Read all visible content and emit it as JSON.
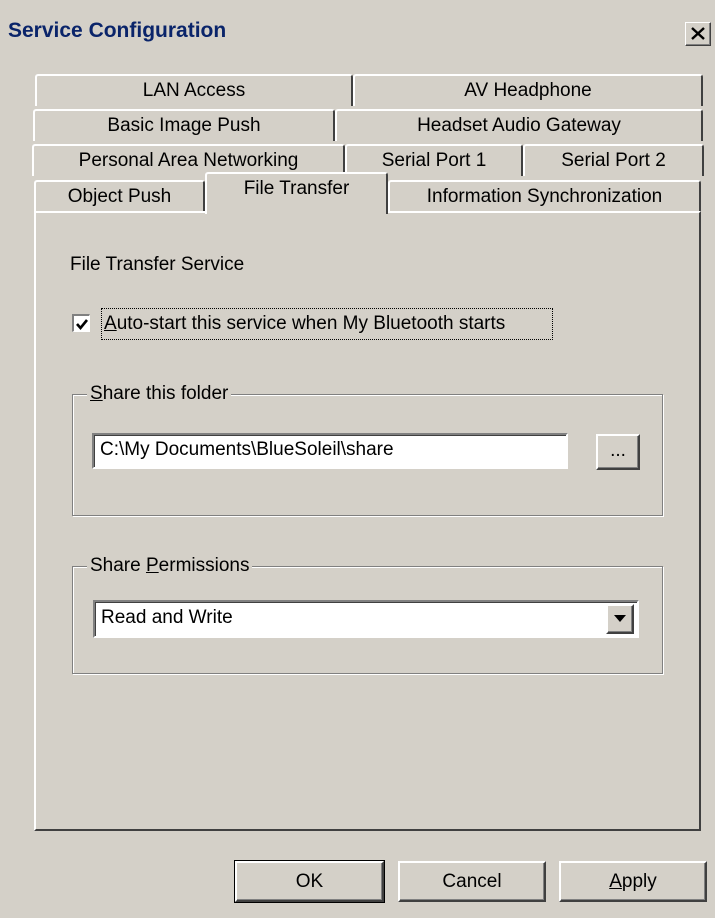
{
  "window": {
    "title": "Service Configuration",
    "close_icon": "close-icon"
  },
  "tabs": {
    "row1": [
      "LAN Access",
      "AV Headphone"
    ],
    "row2": [
      "Basic Image Push",
      "Headset Audio Gateway"
    ],
    "row3": [
      "Personal Area Networking",
      "Serial Port 1",
      "Serial Port 2"
    ],
    "row4": [
      "Object Push",
      "File Transfer",
      "Information Synchronization"
    ],
    "active": "File Transfer"
  },
  "panel": {
    "heading": "File Transfer Service",
    "autostart": {
      "checked": true,
      "label_accel": "A",
      "label_rest": "uto-start this service when My Bluetooth starts"
    },
    "share_folder": {
      "legend_accel": "S",
      "legend_rest": "hare this folder",
      "path": "C:\\My Documents\\BlueSoleil\\share",
      "browse_label": "..."
    },
    "share_permissions": {
      "legend_pre": "Share ",
      "legend_accel": "P",
      "legend_rest": "ermissions",
      "selected": "Read and Write"
    }
  },
  "buttons": {
    "ok": "OK",
    "cancel": "Cancel",
    "apply_accel": "A",
    "apply_rest": "pply"
  }
}
